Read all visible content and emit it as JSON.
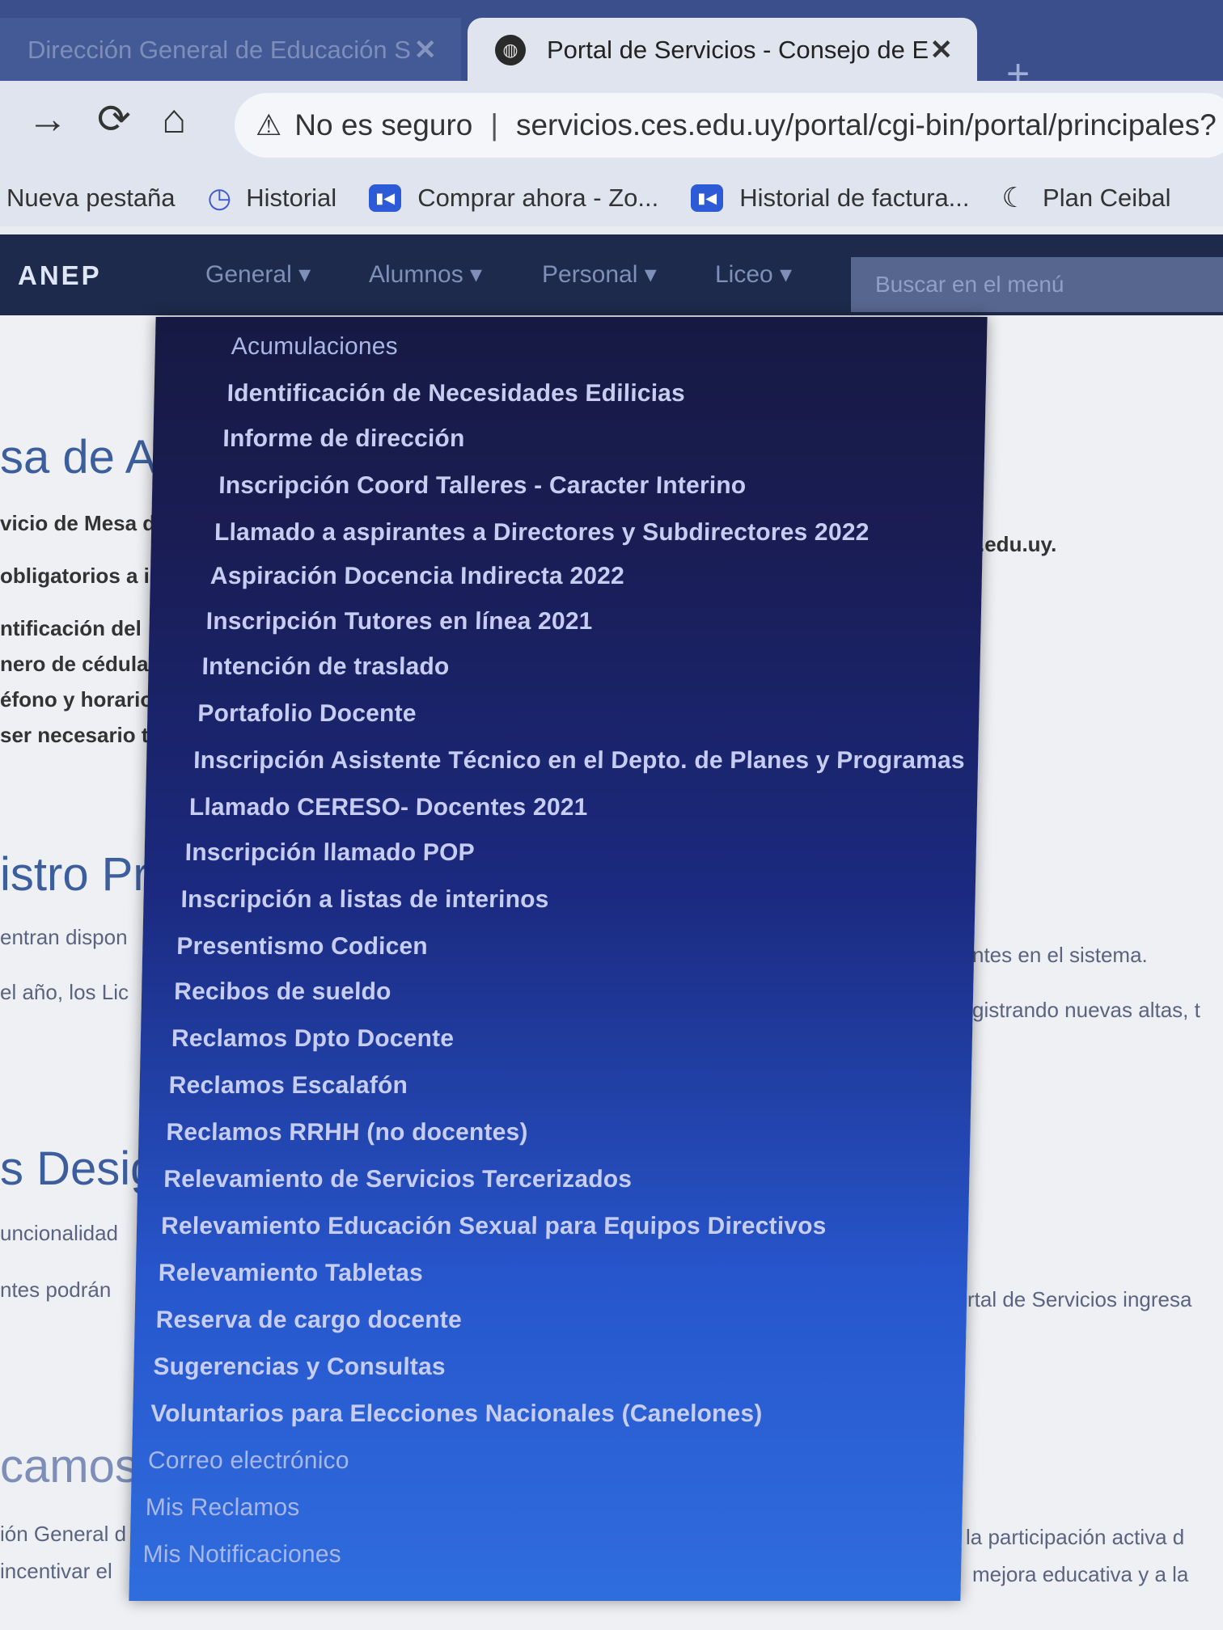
{
  "browser": {
    "tabs": [
      {
        "title": "Dirección General de Educación S",
        "active": false
      },
      {
        "title": "Portal de Servicios - Consejo de E",
        "active": true
      }
    ],
    "security_label": "No es seguro",
    "url": "servicios.ces.edu.uy/portal/cgi-bin/portal/principales?",
    "bookmarks": [
      "Nueva pestaña",
      "Historial",
      "Comprar ahora - Zo...",
      "Historial de factura...",
      "Plan Ceibal"
    ]
  },
  "navbar": {
    "brand": "ANEP",
    "items": [
      "General ▾",
      "Alumnos ▾",
      "Personal ▾",
      "Liceo ▾"
    ],
    "search_placeholder": "Buscar en el menú"
  },
  "dropdown": {
    "items": [
      "Acumulaciones",
      "Identificación de Necesidades Edilicias",
      "Informe de dirección",
      "Inscripción Coord Talleres - Caracter Interino",
      "Llamado a aspirantes a Directores y Subdirectores 2022",
      "Aspiración Docencia Indirecta 2022",
      "Inscripción Tutores en línea 2021",
      "Intención de traslado",
      "Portafolio Docente",
      "Inscripción Asistente Técnico en el Depto. de Planes y Programas",
      "Llamado CERESO- Docentes 2021",
      "Inscripción llamado POP",
      "Inscripción a listas de interinos",
      "Presentismo Codicen",
      "Recibos de sueldo",
      "Reclamos Dpto Docente",
      "Reclamos Escalafón",
      "Reclamos RRHH (no docentes)",
      "Relevamiento de Servicios Tercerizados",
      "Relevamiento Educación Sexual para Equipos Directivos",
      "Relevamiento Tabletas",
      "Reserva de cargo docente",
      "Sugerencias y Consultas",
      "Voluntarios para Elecciones Nacionales (Canelones)",
      "Correo electrónico",
      "Mis Reclamos",
      "Mis Notificaciones"
    ]
  },
  "page_background": {
    "heading1": "sa de Ay",
    "para1": [
      "vicio de Mesa de",
      "obligatorios a ir",
      "ntificación del",
      "nero de cédula",
      "éfono y horario",
      "ser necesario ta"
    ],
    "right1": ".edu.uy.",
    "heading2": "istro Pr",
    "para2": [
      "entran dispon",
      "el año, los Lic"
    ],
    "right2a": "ntes en el sistema.",
    "right2b": "gistrando nuevas altas, t",
    "heading3": "s Desig",
    "para3": [
      "uncionalidad",
      "ntes podrán"
    ],
    "right3": "rtal de Servicios ingresa",
    "heading4": "camos",
    "para4": [
      "ión General d",
      "incentivar el"
    ],
    "right4a": "la participación activa d",
    "right4b": "mejora educativa y a la"
  }
}
